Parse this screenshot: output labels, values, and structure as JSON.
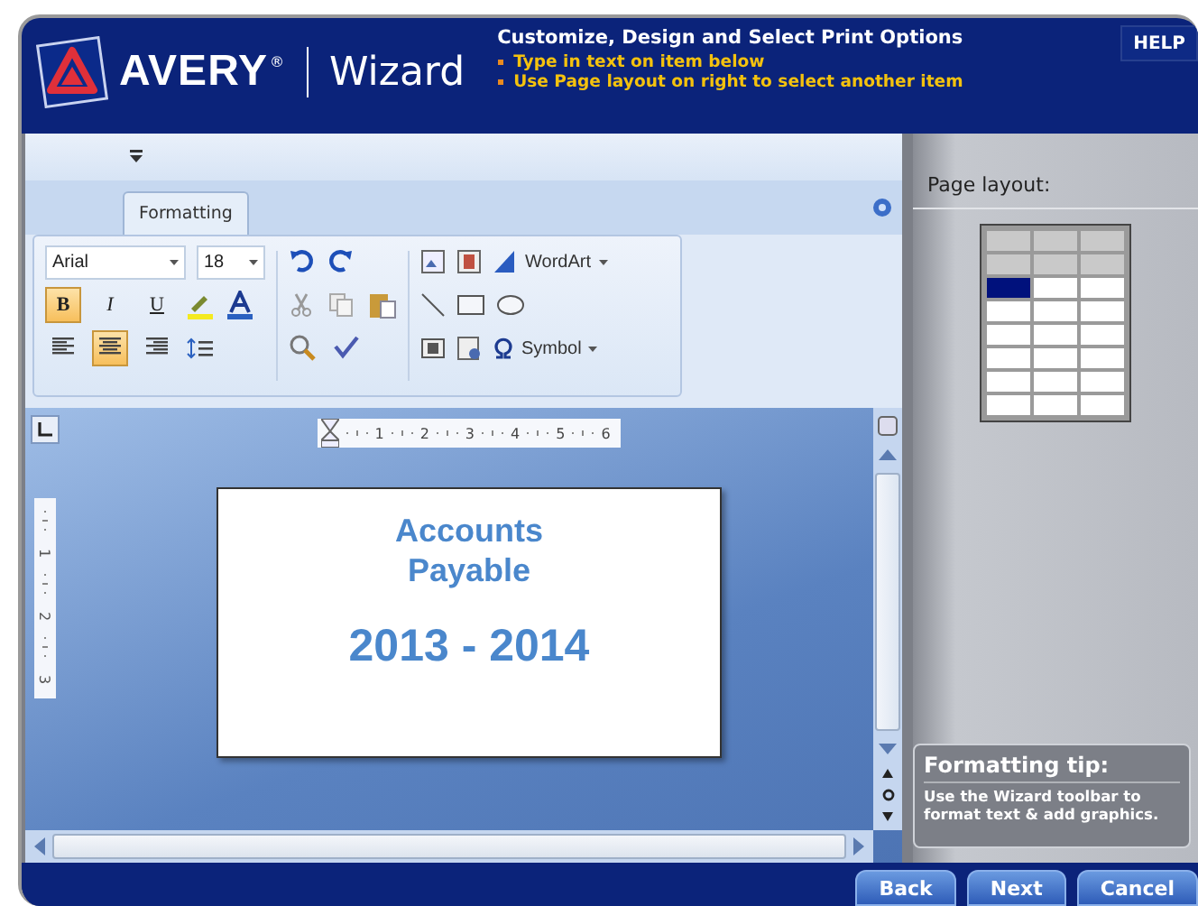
{
  "header": {
    "logo": "AVERY",
    "registered": "®",
    "product": "Wizard",
    "title": "Customize, Design and Select Print Options",
    "steps": [
      "Type in text on item below",
      "Use Page layout on right to select another item"
    ],
    "help": "HELP"
  },
  "ribbon": {
    "tabs": [
      {
        "label": "Formatting",
        "selected": true
      }
    ],
    "font": "Arial",
    "size": "18",
    "styles": [
      {
        "kind": "bold",
        "label": "B",
        "on": true
      },
      {
        "kind": "italic",
        "label": "I",
        "on": false
      },
      {
        "kind": "underline",
        "label": "U",
        "on": false
      }
    ],
    "aligns": [
      {
        "kind": "left",
        "selected": false
      },
      {
        "kind": "center",
        "selected": true
      },
      {
        "kind": "right",
        "selected": false
      }
    ],
    "wordart": "WordArt",
    "symbol": "Symbol"
  },
  "ruler": {
    "marks": [
      "1",
      "2",
      "3",
      "4",
      "5",
      "6"
    ],
    "vertical_marks": [
      "1",
      "2",
      "3"
    ]
  },
  "label_text": [
    "Accounts",
    "Payable",
    "2013 - 2014"
  ],
  "page_layout": {
    "label": "Page layout:",
    "rows": [
      [
        {
          "occupied": true,
          "selected": false
        },
        {
          "occupied": true,
          "selected": false
        },
        {
          "occupied": true,
          "selected": false
        }
      ],
      [
        {
          "occupied": true,
          "selected": false
        },
        {
          "occupied": true,
          "selected": false
        },
        {
          "occupied": true,
          "selected": false
        }
      ],
      [
        {
          "occupied": false,
          "selected": true
        },
        {
          "occupied": false,
          "selected": false
        },
        {
          "occupied": false,
          "selected": false
        }
      ],
      [
        {
          "occupied": false,
          "selected": false
        },
        {
          "occupied": false,
          "selected": false
        },
        {
          "occupied": false,
          "selected": false
        }
      ],
      [
        {
          "occupied": false,
          "selected": false
        },
        {
          "occupied": false,
          "selected": false
        },
        {
          "occupied": false,
          "selected": false
        }
      ],
      [
        {
          "occupied": false,
          "selected": false
        },
        {
          "occupied": false,
          "selected": false
        },
        {
          "occupied": false,
          "selected": false
        }
      ],
      [
        {
          "occupied": false,
          "selected": false
        },
        {
          "occupied": false,
          "selected": false
        },
        {
          "occupied": false,
          "selected": false
        }
      ],
      [
        {
          "occupied": false,
          "selected": false
        },
        {
          "occupied": false,
          "selected": false
        },
        {
          "occupied": false,
          "selected": false
        }
      ]
    ]
  },
  "tip": {
    "title": "Formatting tip:",
    "text": "Use the Wizard toolbar to format text & add graphics."
  },
  "buttons": [
    "Back",
    "Next",
    "Cancel"
  ]
}
